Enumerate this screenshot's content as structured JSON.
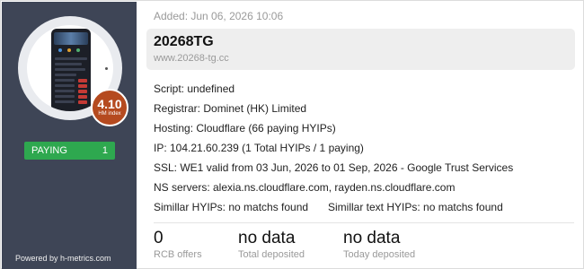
{
  "sidebar": {
    "hm_index_value": "4.10",
    "hm_index_label": "HM index",
    "status_label": "PAYING",
    "status_count": "1",
    "powered_by": "Powered by h-metrics.com",
    "colors": {
      "panel": "#3e4556",
      "paying": "#2ea84f",
      "badge": "#b54a1f"
    }
  },
  "header": {
    "added": "Added: Jun 06, 2026 10:06",
    "name": "20268TG",
    "url": "www.20268-tg.cc"
  },
  "details": {
    "script": "Script: undefined",
    "registrar": "Registrar: Dominet (HK) Limited",
    "hosting": "Hosting: Cloudflare (66 paying HYIPs)",
    "ip": "IP: 104.21.60.239 (1 Total HYIPs / 1 paying)",
    "ssl": "SSL: WE1 valid from 03 Jun, 2026 to 01 Sep, 2026 - Google Trust Services",
    "ns": "NS servers: alexia.ns.cloudflare.com, rayden.ns.cloudflare.com",
    "similar_hyips": "Simillar HYIPs: no matchs found",
    "similar_text": "Simillar text HYIPs: no matchs found"
  },
  "stats": [
    {
      "value": "0",
      "label": "RCB offers"
    },
    {
      "value": "no data",
      "label": "Total deposited"
    },
    {
      "value": "no data",
      "label": "Today deposited"
    }
  ]
}
